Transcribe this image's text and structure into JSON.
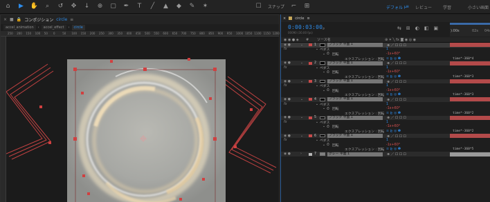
{
  "toolbar": {
    "tools": [
      "home-icon",
      "selection-arrow-icon",
      "hand-icon",
      "zoom-icon",
      "rotate-icon",
      "orbit-icon",
      "pan-icon",
      "dolly-icon",
      "anchor-icon",
      "rect-mask-icon",
      "pen-icon",
      "text-icon",
      "brush-icon",
      "clone-stamp-icon",
      "eraser-icon",
      "roto-icon",
      "puppet-icon"
    ],
    "snap_label": "スナップ",
    "workspaces": [
      "デフォルト",
      "レビュー",
      "学習",
      "小さい画面"
    ]
  },
  "comp_panel": {
    "tab_prefix": "コンポジション",
    "comp_name": "circle",
    "breadcrumbs": [
      "accel_animation",
      "accel_effect",
      "circle"
    ],
    "ruler_ticks": [
      "250",
      "200",
      "150",
      "100",
      "50",
      "0",
      "50",
      "100",
      "150",
      "200",
      "250",
      "300",
      "350",
      "400",
      "450",
      "500",
      "550",
      "600",
      "650",
      "700",
      "750",
      "800",
      "850",
      "900",
      "950",
      "1000",
      "1050",
      "1100",
      "1150",
      "1200"
    ]
  },
  "timeline": {
    "tab_name": "circle",
    "timecode": "0:00:03:00",
    "frames": "00090 (30.00 fps)",
    "search_icon": "search-icon",
    "column_source_name": "ソース名",
    "time_ruler": [
      "):00s",
      "02s",
      "04s"
    ],
    "rows": [
      {
        "kind": "layer",
        "num": "1",
        "name": "ブラック 平面 1",
        "selected": true,
        "grey": false
      },
      {
        "kind": "group",
        "label": "ペダス",
        "value": "1"
      },
      {
        "kind": "prop",
        "label": "回転",
        "value": "-1x+60°"
      },
      {
        "kind": "expr",
        "label": "エクスプレッション : 回転",
        "expr": "time*-360*4"
      },
      {
        "kind": "layer",
        "num": "2",
        "name": "ブラック 平面 1",
        "selected": false,
        "grey": false
      },
      {
        "kind": "group",
        "label": "ペダス",
        "value": "1"
      },
      {
        "kind": "prop",
        "label": "回転",
        "value": "-1x+60°"
      },
      {
        "kind": "expr",
        "label": "エクスプレッション : 回転",
        "expr": "time*-360*3"
      },
      {
        "kind": "layer",
        "num": "3",
        "name": "ブラック 平面 1",
        "selected": false,
        "grey": false
      },
      {
        "kind": "group",
        "label": "ペダス",
        "value": "1"
      },
      {
        "kind": "prop",
        "label": "回転",
        "value": "-1x+60°"
      },
      {
        "kind": "expr",
        "label": "エクスプレッション : 回転",
        "expr": "time*-360*3"
      },
      {
        "kind": "layer",
        "num": "4",
        "name": "ブラック 平面 1",
        "selected": false,
        "grey": false
      },
      {
        "kind": "group",
        "label": "ペダス",
        "value": "1"
      },
      {
        "kind": "prop",
        "label": "回転",
        "value": "-1x+60°"
      },
      {
        "kind": "expr",
        "label": "エクスプレッション : 回転",
        "expr": "time*-360*2"
      },
      {
        "kind": "layer",
        "num": "5",
        "name": "ブラック 平面 1",
        "selected": false,
        "grey": false
      },
      {
        "kind": "group",
        "label": "ペダス",
        "value": "1"
      },
      {
        "kind": "prop",
        "label": "回転",
        "value": "-1x+60°"
      },
      {
        "kind": "expr",
        "label": "エクスプレッション : 回転",
        "expr": "time*-360*2"
      },
      {
        "kind": "layer",
        "num": "6",
        "name": "ブラック 平面 1",
        "selected": false,
        "grey": false
      },
      {
        "kind": "group",
        "label": "ペダス",
        "value": "1"
      },
      {
        "kind": "prop",
        "label": "回転",
        "value": "-1x+60°"
      },
      {
        "kind": "expr",
        "label": "エクスプレッション : 回転",
        "expr": "time*-360*5"
      },
      {
        "kind": "layer",
        "num": "7",
        "name": "グレー 平面 1",
        "selected": false,
        "grey": true
      }
    ]
  },
  "colors": {
    "accent": "#2d8ceb",
    "layer_label": "#c94a4a",
    "bar": "#b34a4a",
    "handle": "#d04040"
  }
}
